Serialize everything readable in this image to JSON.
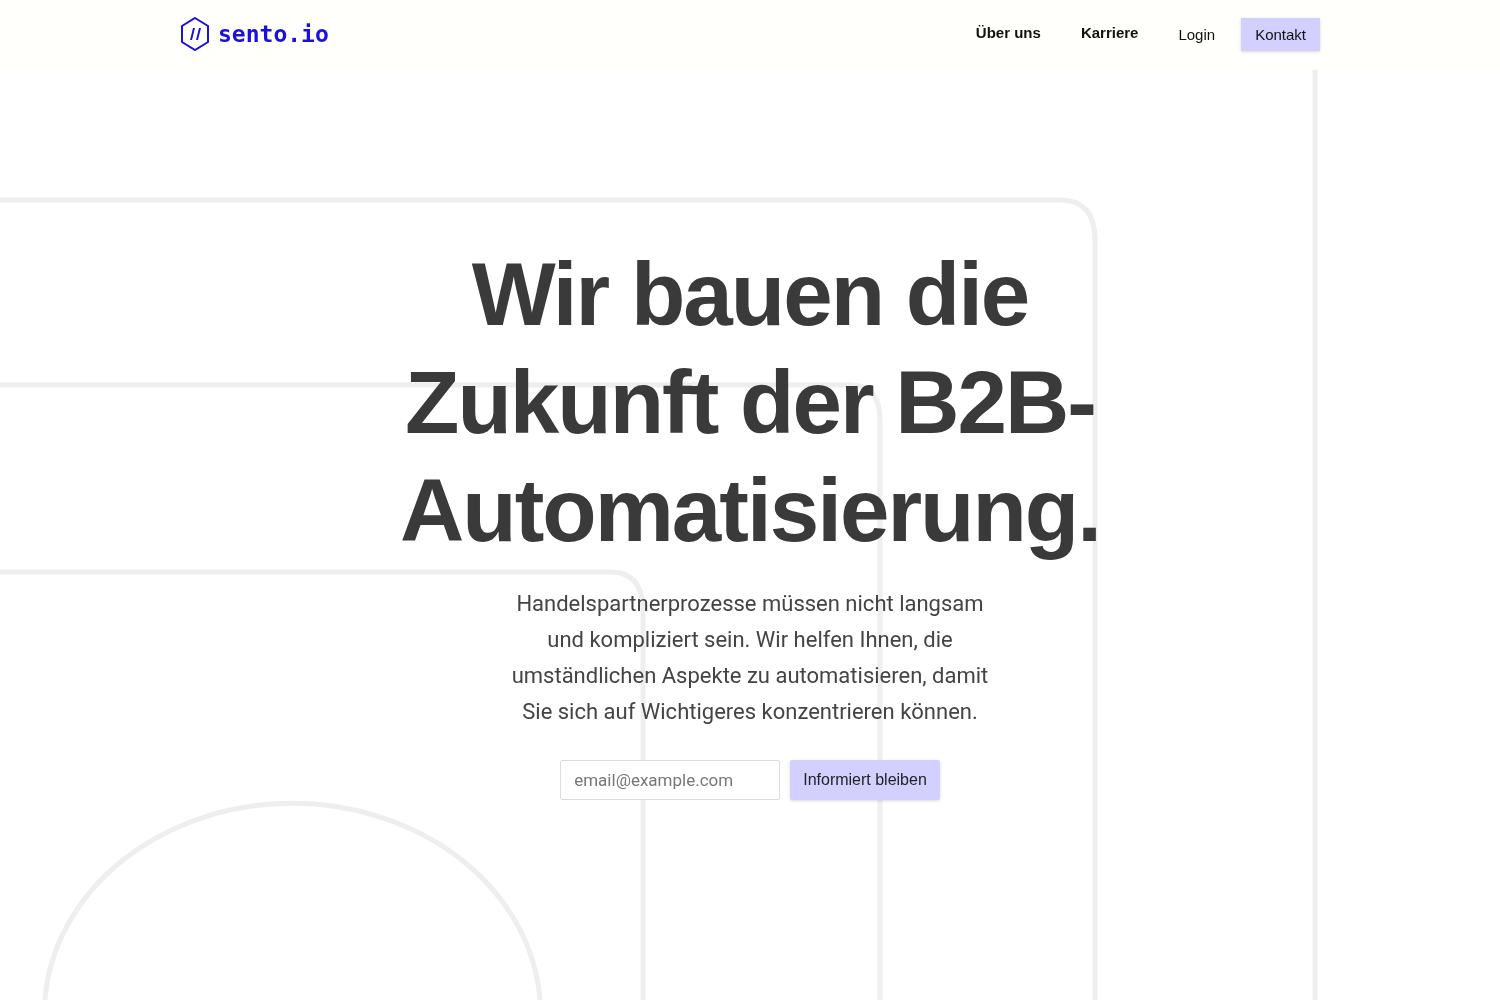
{
  "header": {
    "logo": "sento.io",
    "nav": [
      {
        "label": "Über uns",
        "kind": "link"
      },
      {
        "label": "Karriere",
        "kind": "link"
      },
      {
        "label": "Login",
        "kind": "plain"
      },
      {
        "label": "Kontakt",
        "kind": "button"
      }
    ]
  },
  "hero": {
    "title": "Wir bauen die Zukunft der B2B-Automatisierung.",
    "text": "Handelspartnerprozesse müssen nicht langsam und kompliziert sein. Wir helfen Ihnen, die umständlichen Aspekte zu automatisieren, damit Sie sich auf Wichtigeres konzentrieren können.",
    "signup": {
      "placeholder": "email@example.com",
      "button": "Informiert bleiben"
    }
  }
}
